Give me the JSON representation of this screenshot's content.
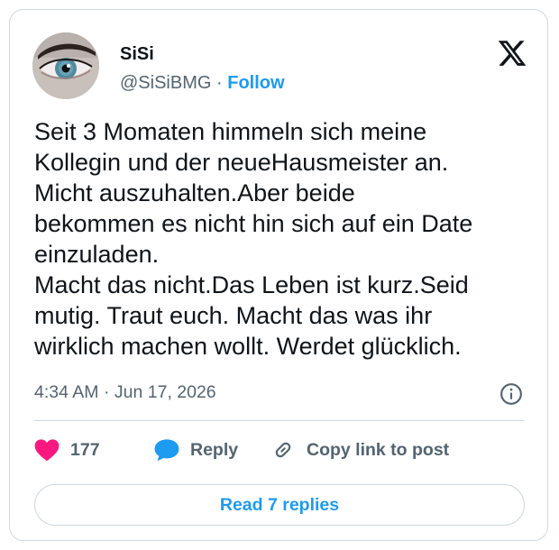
{
  "author": {
    "name": "SiSi",
    "handle": "@SiSiBMG",
    "separator": "·",
    "follow_label": "Follow"
  },
  "tweet": {
    "lines": [
      "Seit 3 Momaten himmeln sich meine",
      "Kollegin und der neueHausmeister an.",
      "Micht auszuhalten.Aber beide",
      "bekommen es nicht hin sich auf ein Date",
      "einzuladen.",
      "Macht das nicht.Das Leben ist kurz.Seid",
      "mutig. Traut euch. Macht das was ihr",
      "wirklich machen wollt. Werdet glücklich."
    ],
    "time": "4:34 AM",
    "date_separator": "·",
    "date": "Jun 17, 2026"
  },
  "actions": {
    "like_count": "177",
    "reply_label": "Reply",
    "copy_label": "Copy link to post",
    "read_replies_label": "Read 7 replies"
  },
  "icons": {
    "logo": "x-logo-icon",
    "info": "info-icon",
    "like": "heart-icon",
    "reply": "speech-bubble-icon",
    "copy": "link-icon"
  },
  "colors": {
    "accent": "#1d9bf0",
    "like": "#f91880",
    "text": "#0f1419",
    "muted": "#536471",
    "border": "#cfd9de"
  }
}
